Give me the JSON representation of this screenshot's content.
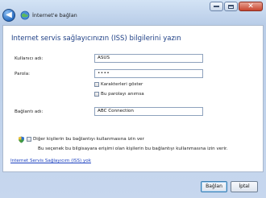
{
  "window": {
    "title": "İnternet'e bağlan",
    "controls": {
      "minimize": "minimize",
      "maximize": "maximize",
      "close": "✕"
    }
  },
  "heading": "Internet servis sağlayıcınızın (ISS) bilgilerini yazın",
  "form": {
    "username": {
      "label": "Kullanıcı adı:",
      "value": "ASUS"
    },
    "password": {
      "label": "Parola:",
      "value": "••••"
    },
    "show_chars": {
      "label": "Karakterleri göster",
      "checked": false
    },
    "remember": {
      "label": "Bu parolayı anımsa",
      "checked": false
    },
    "connection_name": {
      "label": "Bağlantı adı:",
      "value": "ABC Connection"
    },
    "allow_others": {
      "label": "Diğer kişilerin bu bağlantıyı kullanmasına izin ver",
      "checked": false
    },
    "allow_note": "Bu seçenek bu bilgisayara erişimi olan kişilerin bu bağlantıyı kullanmasına izin verir."
  },
  "link": "Internet Servis Sağlayıcım (ISS) yok",
  "buttons": {
    "connect": "Bağlan",
    "cancel": "İptal"
  },
  "icons": {
    "back": "back-arrow-icon",
    "network": "network-globe-icon",
    "shield": "uac-shield-icon"
  }
}
